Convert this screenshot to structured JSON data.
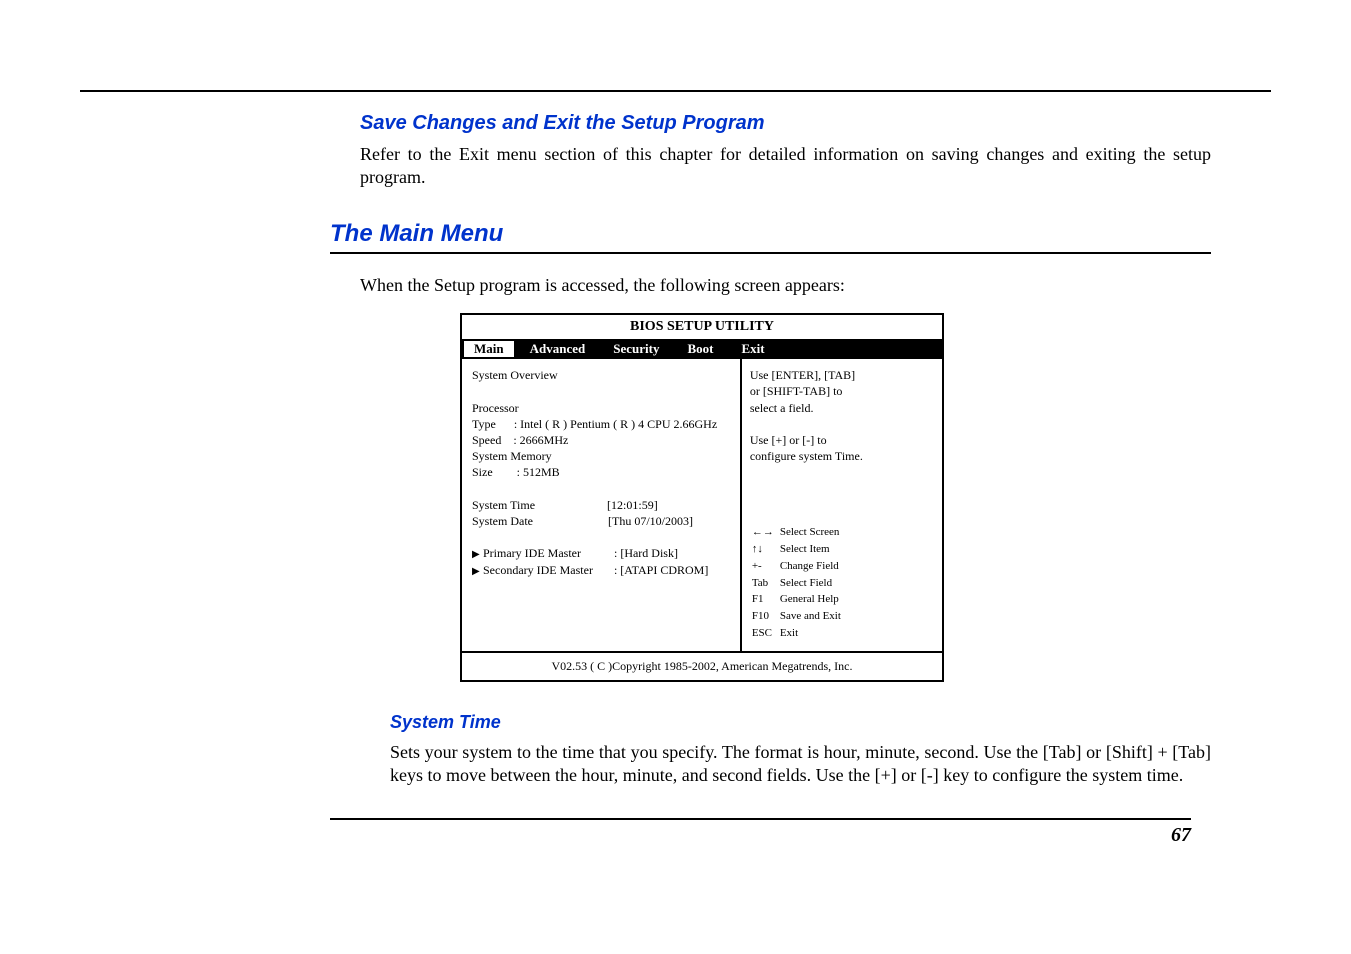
{
  "headings": {
    "save_exit": "Save Changes and Exit the Setup Program",
    "main_menu": "The Main Menu",
    "system_time": "System Time"
  },
  "paragraphs": {
    "save_exit_body": "Refer to the Exit menu section of this chapter for detailed information on saving changes and exiting the setup program.",
    "main_intro": "When the Setup program is accessed, the following screen appears:",
    "system_time_body": "Sets your system to the time that you specify. The format is hour, minute, second.  Use the [Tab] or [Shift] + [Tab] keys to move between the hour, minute, and second fields.  Use the [+] or [-] key to configure the system time."
  },
  "bios": {
    "title": "BIOS SETUP UTILITY",
    "tabs": [
      "Main",
      "Advanced",
      "Security",
      "Boot",
      "Exit"
    ],
    "left_overview": "System Overview",
    "left_processor_label": "Processor",
    "left_type": "Type      : Intel ( R ) Pentium ( R ) 4 CPU 2.66GHz",
    "left_speed": "Speed    : 2666MHz",
    "left_memory_label": "System Memory",
    "left_size": "Size        : 512MB",
    "left_time_label": "System Time",
    "left_time_value": "[12:01:59]",
    "left_date_label": "System Date",
    "left_date_value": "[Thu 07/10/2003]",
    "left_primary": "Primary IDE Master",
    "left_primary_value": ": [Hard Disk]",
    "left_secondary": "Secondary IDE Master",
    "left_secondary_value": ": [ATAPI CDROM]",
    "right_top": "Use [ENTER], [TAB]\nor [SHIFT-TAB] to\nselect a field.\n\nUse [+] or [-] to\nconfigure system Time.",
    "keys": {
      "lr": "←→",
      "lr_label": "Select Screen",
      "ud": "↑↓",
      "ud_label": "Select Item",
      "pm": "+-",
      "pm_label": "Change Field",
      "tab": "Tab",
      "tab_label": "Select Field",
      "f1": "F1",
      "f1_label": "General Help",
      "f10": "F10",
      "f10_label": "Save and Exit",
      "esc": "ESC",
      "esc_label": "Exit"
    },
    "footer": "V02.53 ( C )Copyright 1985-2002, American Megatrends, Inc."
  },
  "page_number": "67"
}
